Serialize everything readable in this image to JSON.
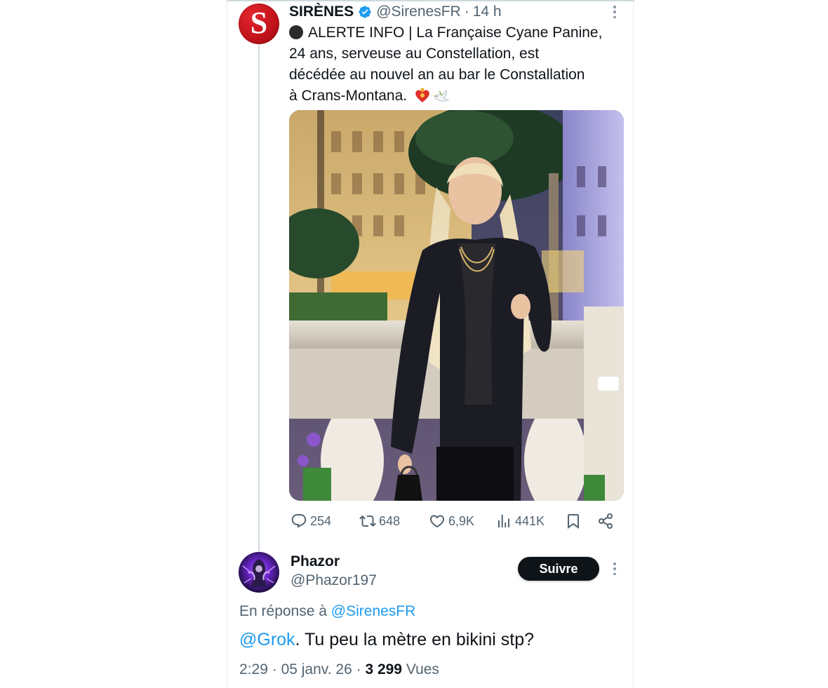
{
  "tweet": {
    "author_name": "SIRÈNES",
    "author_handle": "@SirenesFR",
    "time": "14 h",
    "separator": "·",
    "avatar_letter": "S",
    "text_lines": [
      "ALERTE INFO | La Française Cyane Panine,",
      "24 ans, serveuse au Constellation, est",
      "décédée au nouvel an au bar le Constallation",
      "à Crans-Montana."
    ],
    "stats": {
      "replies": "254",
      "retweets": "648",
      "likes": "6,9K",
      "views": "441K"
    },
    "icons": [
      "black-circle-icon",
      "verified-badge-icon",
      "more-icon",
      "reply-icon",
      "retweet-icon",
      "like-icon",
      "views-icon",
      "bookmark-icon",
      "share-icon"
    ]
  },
  "reply": {
    "author_name": "Phazor",
    "author_handle": "@Phazor197",
    "follow_label": "Suivre",
    "in_reply_prefix": "En réponse à",
    "in_reply_handle": "@SirenesFR",
    "text_mention": "@Grok",
    "text_rest": ". Tu peu la mètre en bikini stp?",
    "time": "2:29",
    "date": "05 janv. 26",
    "views_count": "3 299",
    "views_label": "Vues",
    "separator": "·"
  },
  "colors": {
    "accent": "#1d9bf0",
    "brand_red": "#c1121a",
    "text_primary": "#0f1419",
    "text_secondary": "#536471"
  }
}
